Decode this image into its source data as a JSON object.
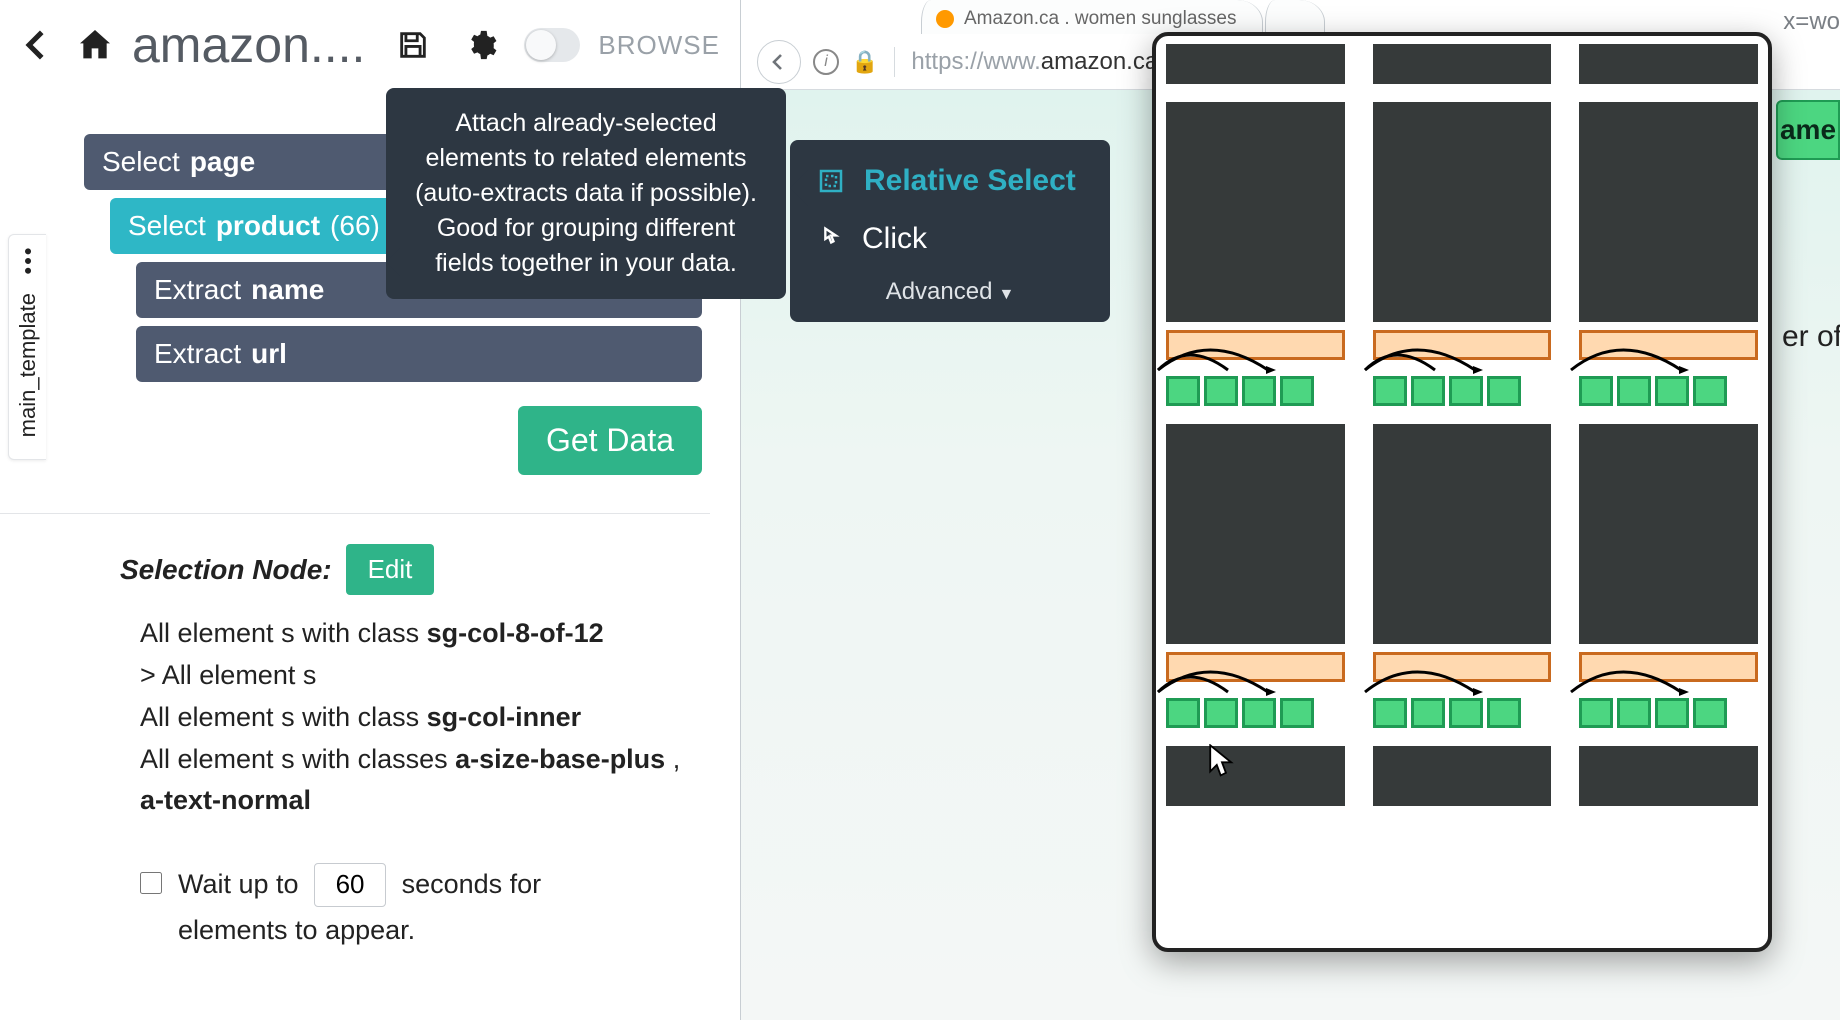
{
  "topbar": {
    "title": "amazon....",
    "browse": "BROWSE"
  },
  "template_tab": {
    "label": "main_template"
  },
  "tree": {
    "page_kw": "Select",
    "page_nm": "page",
    "product_kw": "Select",
    "product_nm": "product",
    "product_count": "(66)",
    "extract1_kw": "Extract",
    "extract1_nm": "name",
    "extract2_kw": "Extract",
    "extract2_nm": "url"
  },
  "getdata_label": "Get Data",
  "tooltip": "Attach already-selected elements to related elements (auto-extracts data if possible). Good for grouping different fields together in your data.",
  "popover": {
    "relative": "Relative Select",
    "click": "Click",
    "advanced": "Advanced"
  },
  "selnode": {
    "header": "Selection Node:",
    "edit": "Edit",
    "line1a": "All element s with class ",
    "line1b": "sg-col-8-of-12",
    "line2": "> All element s",
    "line3a": "All element s with class ",
    "line3b": "sg-col-inner",
    "line4a": "All element s with classes ",
    "line4b": "a-size-base-plus",
    "line4c": " , ",
    "line4d": "a-text-normal",
    "wait_pre": "Wait up to ",
    "wait_val": "60",
    "wait_post": " seconds for elements to appear."
  },
  "browser": {
    "tab1": "Amazon.ca . women sunglasses",
    "url_pre": "https://www.",
    "host": "amazon.ca",
    "url_post_visible": "x=wo",
    "strip": "ame",
    "side_text": "er of"
  }
}
